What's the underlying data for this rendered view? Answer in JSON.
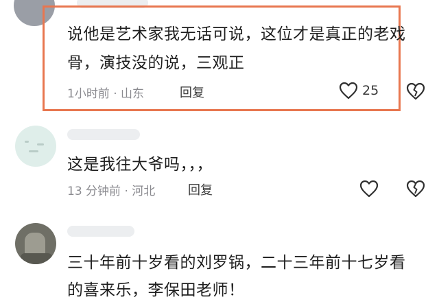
{
  "comments": [
    {
      "text_line1": "说他是艺术家我无话可说，这位才是真正的老戏",
      "text_line2": "骨，演技没的说，三观正",
      "meta": "1小时前 · 山东",
      "reply_label": "回复",
      "like_count": "25"
    },
    {
      "text_line1": "这是我往大爷吗，，，",
      "meta": "13 分钟前 · 河北",
      "reply_label": "回复"
    },
    {
      "text_line1": "三十年前十岁看的刘罗锅，二十三年前十七岁看",
      "text_line2": "的喜来乐，李保田老师！"
    }
  ],
  "colors": {
    "highlight_border": "#e8764f",
    "meta_text": "#8a8a8f"
  },
  "icons": [
    "heart-icon",
    "broken-heart-icon"
  ]
}
